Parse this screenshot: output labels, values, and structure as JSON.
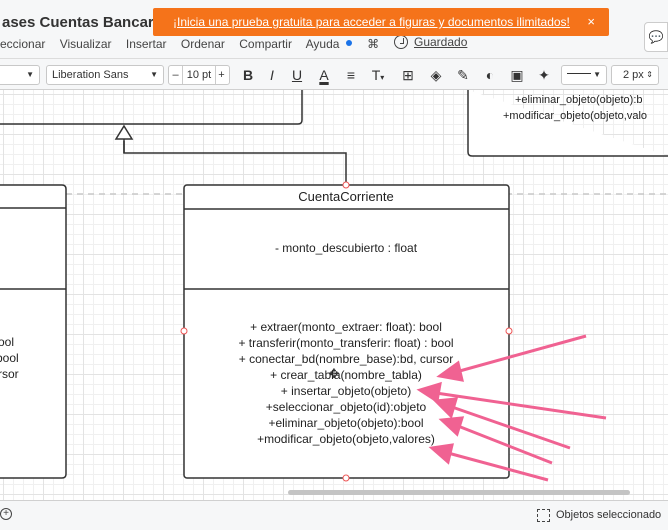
{
  "header": {
    "doc_title": "ases Cuentas Bancaria",
    "menu": [
      "eccionar",
      "Visualizar",
      "Insertar",
      "Ordenar",
      "Compartir",
      "Ayuda"
    ],
    "saved_label": "Guardado",
    "banner_text": "¡Inicia una prueba gratuita para acceder a figuras y documentos ilimitados!",
    "banner_close": "×",
    "colors": {
      "banner": "#f5731a",
      "accent": "#1a73e8"
    }
  },
  "toolbar": {
    "font_name": "Liberation Sans",
    "font_size": "10 pt",
    "line_width": "2 px",
    "minus": "–",
    "plus": "+",
    "bold": "B",
    "italic": "I",
    "underline": "U",
    "font_color": "A",
    "icons": [
      "paragraph-style-icon",
      "bold-icon",
      "italic-icon",
      "underline-icon",
      "font-color-icon",
      "align-icon",
      "text-options-icon",
      "position-icon",
      "fill-color-icon",
      "line-color-icon",
      "opacity-icon",
      "style-icon",
      "magic-icon",
      "line-style-icon"
    ]
  },
  "diagram": {
    "top_right_methods": [
      "+eliminar_objeto(objeto):b",
      "+modificar_objeto(objeto,valo"
    ],
    "left_fragments": [
      "ool",
      "bool",
      "rsor"
    ],
    "class_name": "CuentaCorriente",
    "attributes": [
      "- monto_descubierto : float"
    ],
    "methods": [
      "+ extraer(monto_extraer: float): bool",
      "+ transferir(monto_transferir: float) : bool",
      "+ conectar_bd(nombre_base):bd, cursor",
      "+ crear_tabla(nombre_tabla)",
      "+ insertar_objeto(objeto)",
      "+seleccionar_objeto(id):objeto",
      "+eliminar_objeto(objeto):bool",
      "+modificar_objeto(objeto,valores)"
    ],
    "arrow_color": "#f06292"
  },
  "status": {
    "selected_text": "Objetos seleccionado"
  }
}
